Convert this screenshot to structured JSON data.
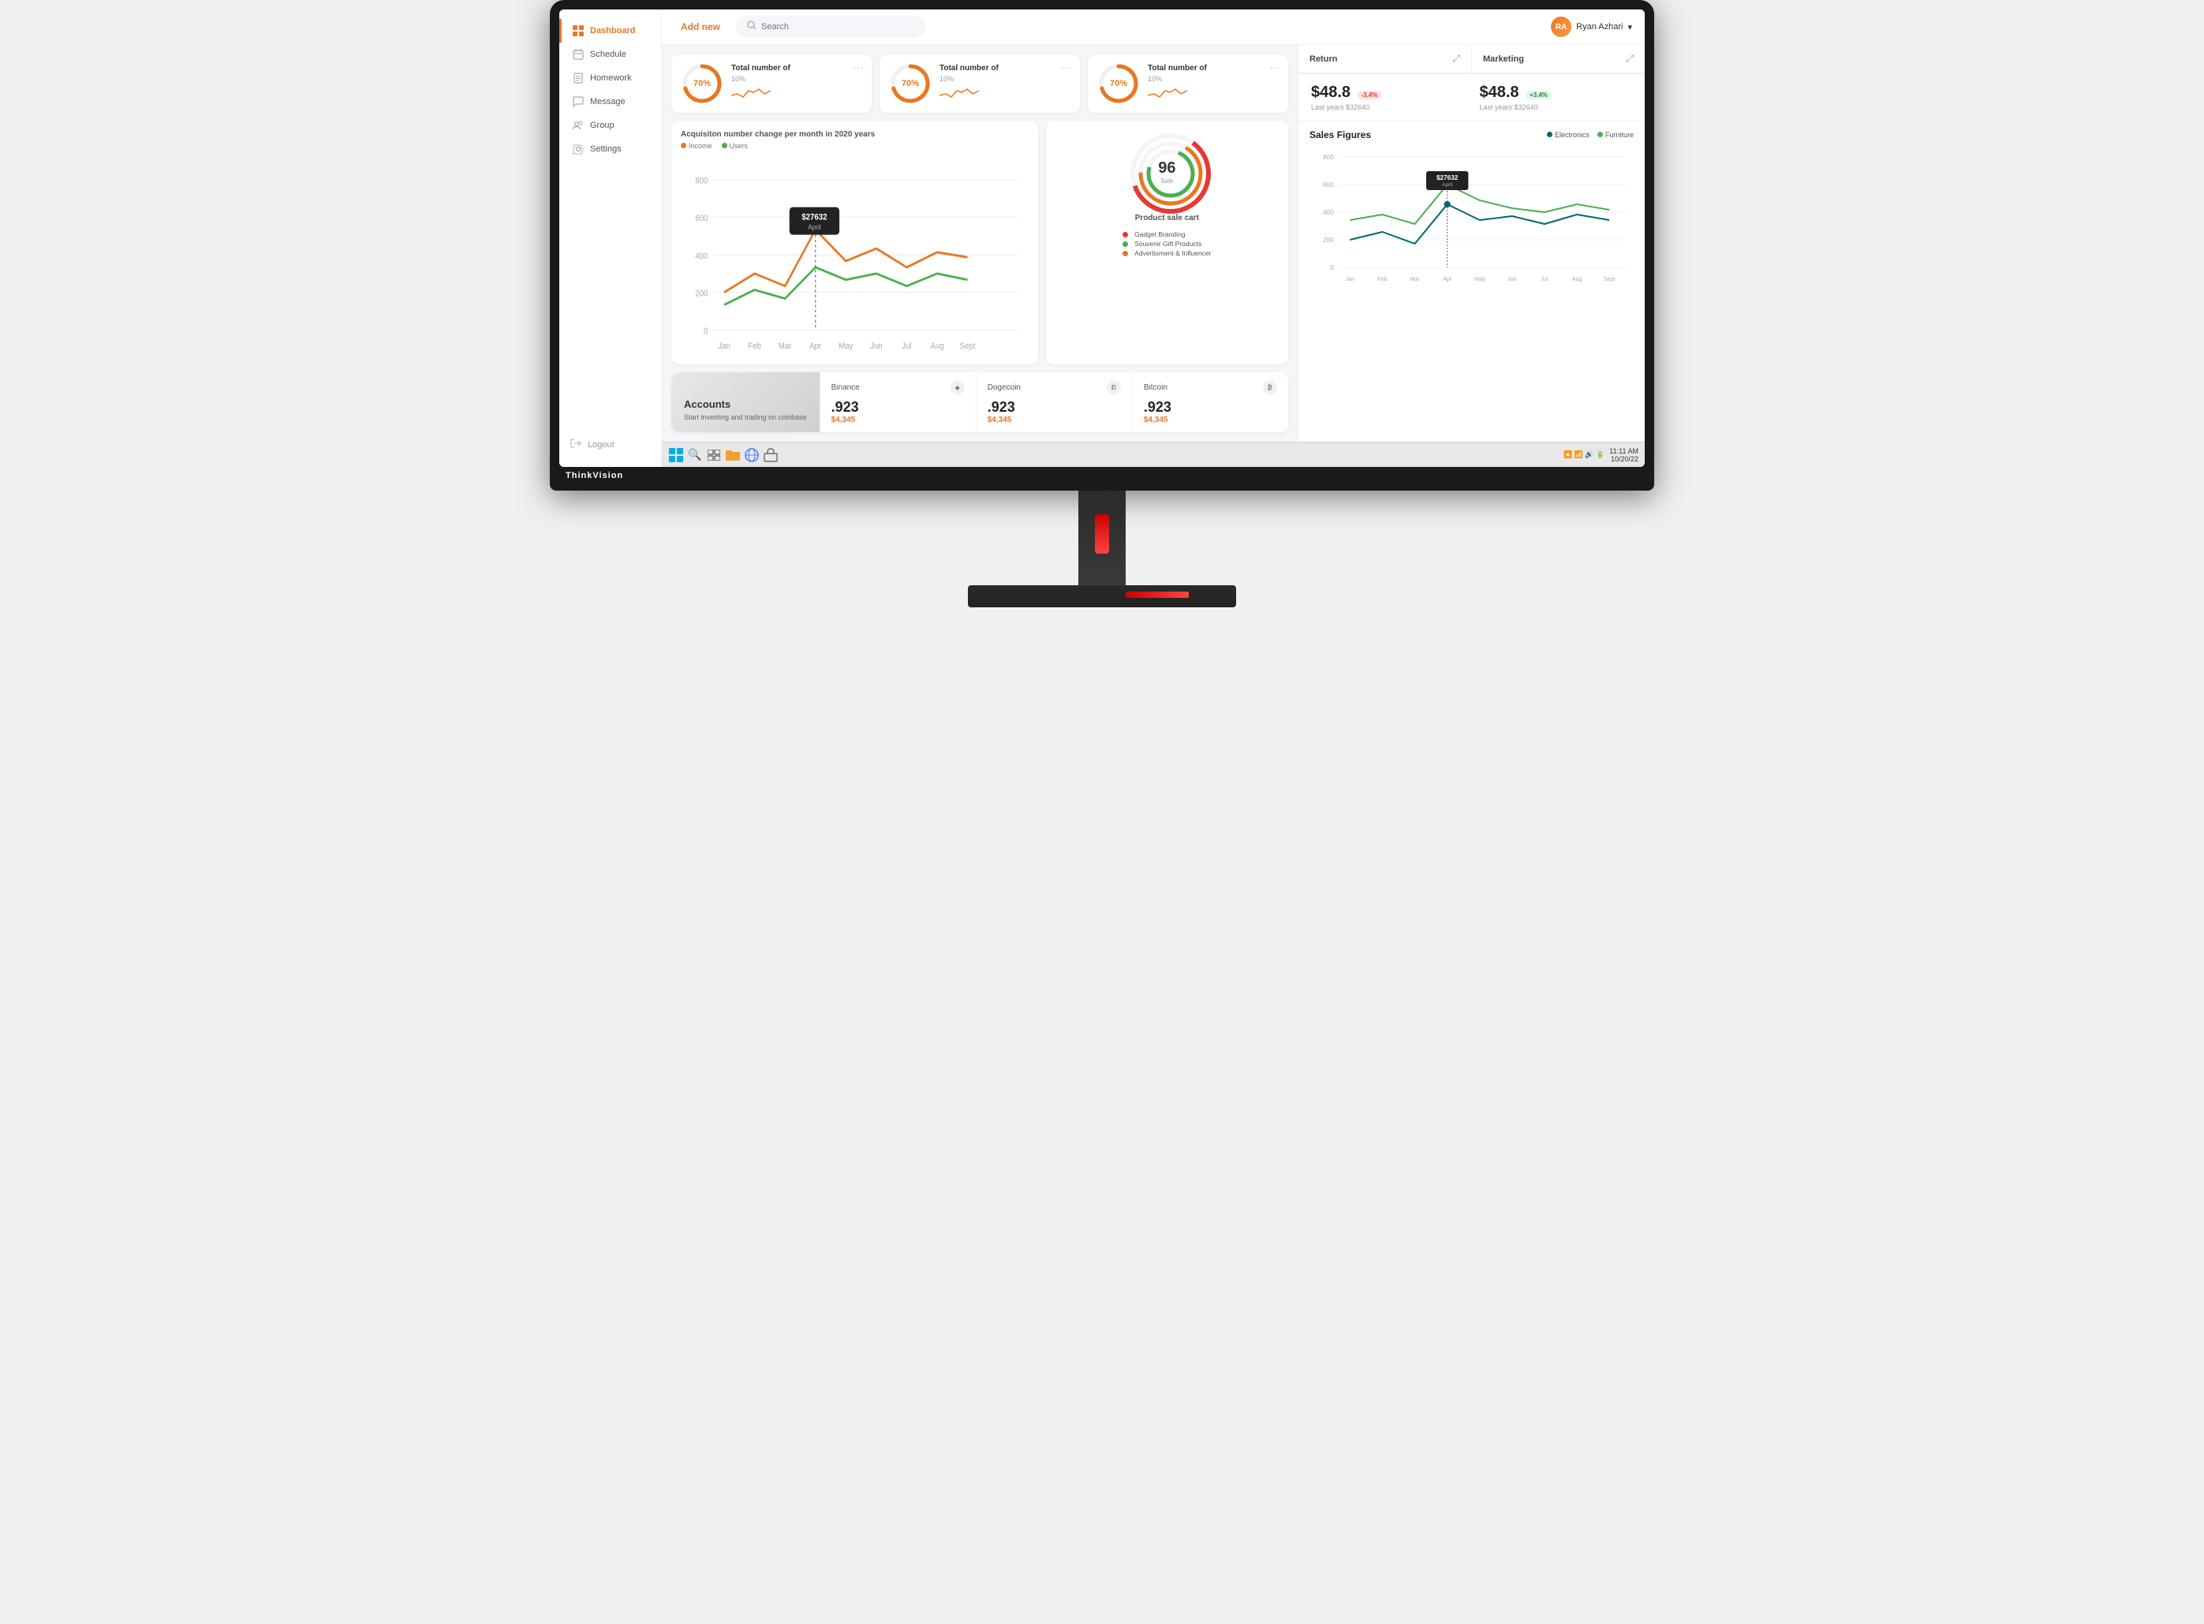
{
  "monitor": {
    "brand": "ThinkVision"
  },
  "topbar": {
    "add_new_label": "Add new",
    "search_placeholder": "Search",
    "user_name": "Ryan Azhari",
    "user_initials": "RA"
  },
  "sidebar": {
    "items": [
      {
        "id": "dashboard",
        "label": "Dashboard",
        "active": true
      },
      {
        "id": "schedule",
        "label": "Schedule",
        "active": false
      },
      {
        "id": "homework",
        "label": "Homework",
        "active": false
      },
      {
        "id": "message",
        "label": "Message",
        "active": false
      },
      {
        "id": "group",
        "label": "Group",
        "active": false
      },
      {
        "id": "settings",
        "label": "Settings",
        "active": false
      }
    ],
    "logout": "Logout"
  },
  "stats": [
    {
      "percent": 70,
      "label": "70%",
      "title": "Total number of",
      "sub": "10%",
      "color": "#e87722"
    },
    {
      "percent": 70,
      "label": "70%",
      "title": "Total number of",
      "sub": "10%",
      "color": "#e87722"
    },
    {
      "percent": 70,
      "label": "70%",
      "title": "Total number of",
      "sub": "10%",
      "color": "#e87722"
    }
  ],
  "acquisition_chart": {
    "title": "Acquisiton number change per month in 2020 years",
    "legend": [
      "Income",
      "Users"
    ],
    "annotation_value": "$27632",
    "annotation_label": "April",
    "x_labels": [
      "Jan",
      "Feb",
      "Mar",
      "Apr",
      "May",
      "Jun",
      "Jul",
      "Aug",
      "Sept"
    ],
    "y_labels": [
      "800",
      "600",
      "400",
      "200",
      "0"
    ]
  },
  "product_sale": {
    "title": "Product sale cart",
    "gauge_value": "96",
    "gauge_sub": "Sale",
    "legend": [
      {
        "color": "#e53935",
        "label": "Gadget Branding"
      },
      {
        "color": "#4caf50",
        "label": "Souvenir Gift Products"
      },
      {
        "color": "#e87722",
        "label": "Advertisment & Influencer"
      }
    ]
  },
  "accounts": {
    "title": "Accounts",
    "description": "Start investing and trading on coinbase",
    "items": [
      {
        "name": "Binance",
        "value": ".923",
        "price": "$4,345"
      },
      {
        "name": "Dogecoin",
        "value": ".923",
        "price": "$4,345"
      },
      {
        "name": "Bitcoin",
        "value": ".923",
        "price": "$4,345"
      }
    ]
  },
  "right_panel": {
    "return_section": {
      "title": "Return",
      "amount1": "$48.8",
      "badge1": "-3.4%",
      "badge1_type": "red",
      "sub1": "Last years $32640",
      "amount2": "$48.8",
      "badge2": "+3.4%",
      "badge2_type": "green",
      "sub2": "Last years $32640",
      "panel2_title": "Marketing"
    },
    "sales_figures": {
      "title": "Sales Figures",
      "legend": [
        "Electronics",
        "Furniture"
      ],
      "annotation_value": "$27632",
      "annotation_label": "April",
      "x_labels": [
        "Jan",
        "Feb",
        "Mar",
        "Apr",
        "May",
        "Jun",
        "Jul",
        "Aug",
        "Sept"
      ],
      "y_labels": [
        "800",
        "600",
        "400",
        "200",
        "0"
      ]
    }
  },
  "taskbar": {
    "time": "11:11 AM",
    "date": "10/20/22",
    "icons": [
      "⊞",
      "🔍",
      "▣",
      "⬜",
      "📹",
      "📁",
      "🌐",
      "⬜"
    ]
  }
}
